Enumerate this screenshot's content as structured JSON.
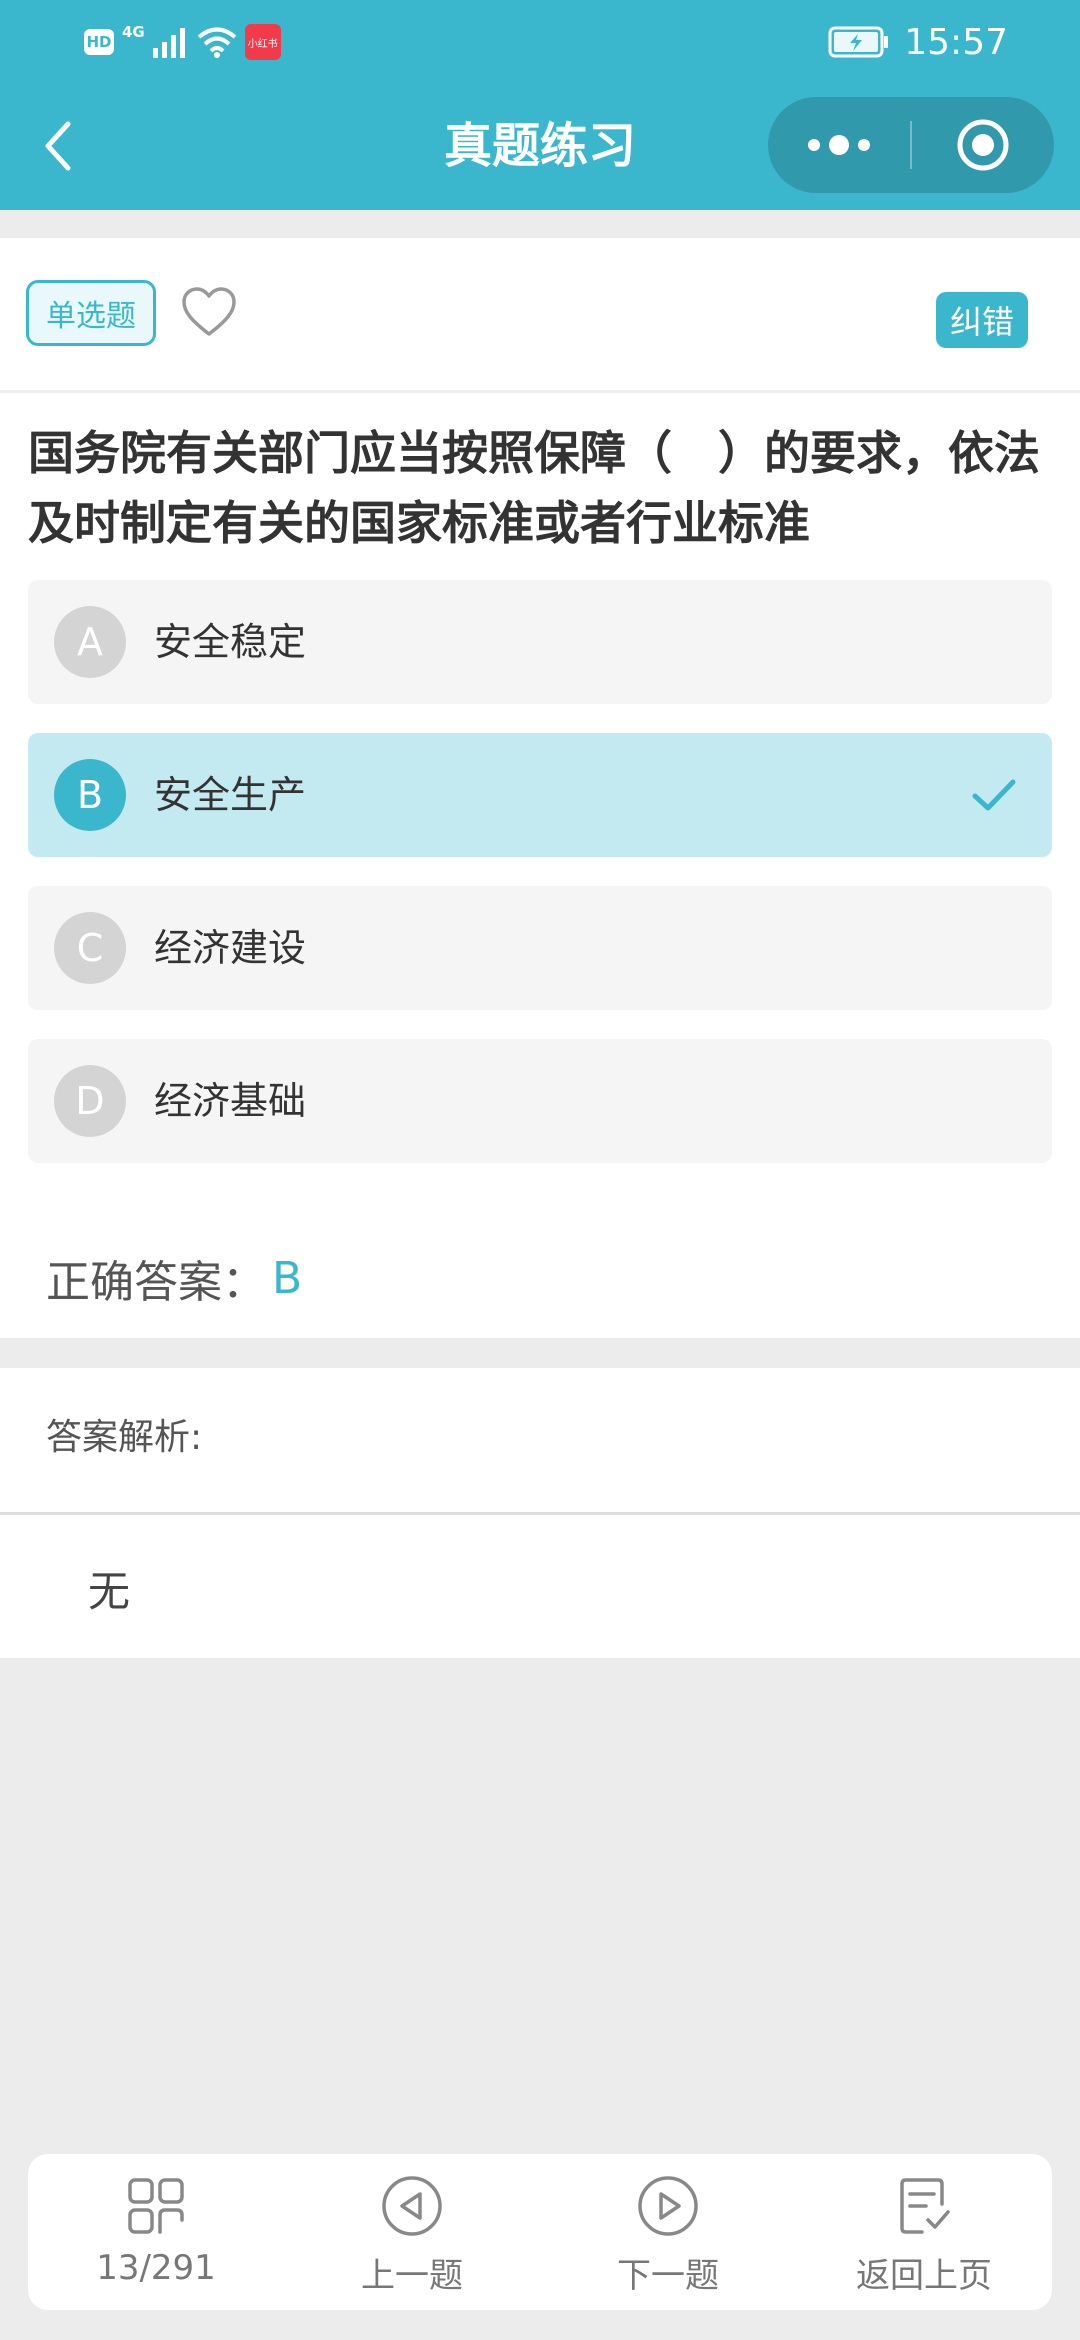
{
  "status_bar": {
    "hd": "HD",
    "network": "4G",
    "app_badge": "小红书",
    "time": "15:57"
  },
  "header": {
    "title": "真题练习",
    "back_icon": "chevron-left-icon",
    "more_icon": "more-dots-icon",
    "close_icon": "target-close-icon"
  },
  "question": {
    "type_tag": "单选题",
    "favorite_icon": "heart-outline-icon",
    "report_label": "纠错",
    "text": "国务院有关部门应当按照保障（　）的要求，依法及时制定有关的国家标准或者行业标准",
    "options": [
      {
        "letter": "A",
        "text": "安全稳定",
        "selected": false
      },
      {
        "letter": "B",
        "text": "安全生产",
        "selected": true
      },
      {
        "letter": "C",
        "text": "经济建设",
        "selected": false
      },
      {
        "letter": "D",
        "text": "经济基础",
        "selected": false
      }
    ],
    "answer_label": "正确答案：",
    "answer_value": "B"
  },
  "analysis": {
    "label": "答案解析:",
    "content": "无"
  },
  "bottom_nav": {
    "progress": "13/291",
    "prev": "上一题",
    "next": "下一题",
    "back": "返回上页"
  },
  "colors": {
    "accent": "#3bb7cd",
    "selected_bg": "#c3eaf0",
    "page_bg": "#ececec"
  }
}
